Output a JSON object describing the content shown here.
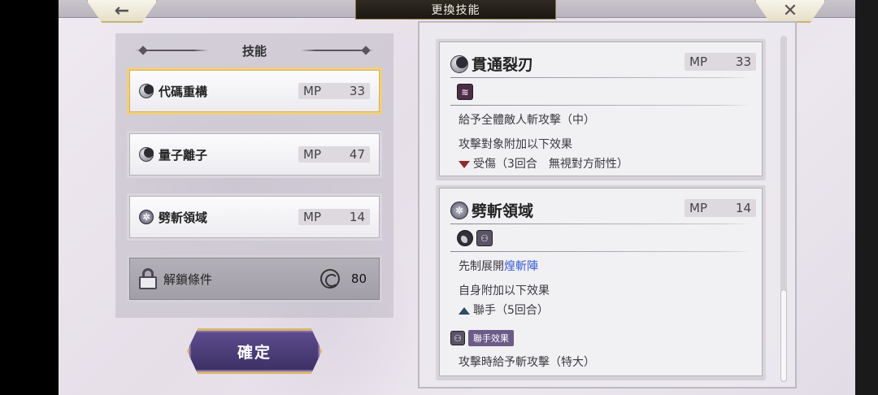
{
  "header": {
    "title": "更換技能",
    "back_icon": "←",
    "close_icon": "✕"
  },
  "skills_panel": {
    "heading": "技能",
    "items": [
      {
        "name": "代碼重構",
        "mp_label": "MP",
        "mp": "33",
        "icon": "moon-icon",
        "selected": true
      },
      {
        "name": "量子離子",
        "mp_label": "MP",
        "mp": "47",
        "icon": "moon-icon",
        "selected": false
      },
      {
        "name": "劈斬領域",
        "mp_label": "MP",
        "mp": "14",
        "icon": "star-icon",
        "selected": false
      }
    ],
    "unlock": {
      "label": "解鎖條件",
      "value": "80",
      "icon": "spiral-icon"
    }
  },
  "confirm_label": "確定",
  "details": [
    {
      "name": "貫通裂刃",
      "mp_label": "MP",
      "mp": "33",
      "icon": "moon-icon",
      "tags": [
        "claw-icon"
      ],
      "lines": [
        "給予全體敵人斬攻擊（中）",
        "攻擊對象附加以下效果"
      ],
      "effect": "受傷（3回合　無視對方耐性）",
      "effect_icon": "debuff-arrow-down-icon"
    },
    {
      "name": "劈斬領域",
      "mp_label": "MP",
      "mp": "14",
      "icon": "star-icon",
      "tags": [
        "moon-icon",
        "pair-icon"
      ],
      "line1_prefix": "先制展開",
      "line1_link": "煌斬陣",
      "line2": "自身附加以下效果",
      "effect": "聯手（5回合）",
      "effect_icon": "buff-arrow-up-icon",
      "combo_label": "聯手效果",
      "combo_text": "攻擊時給予斬攻擊（特大）"
    }
  ],
  "colors": {
    "selected_border": "#f0cf7e",
    "link": "#3a5cd6",
    "confirm_bg": "#4c3f78",
    "combo_badge": "#6c5b88"
  }
}
